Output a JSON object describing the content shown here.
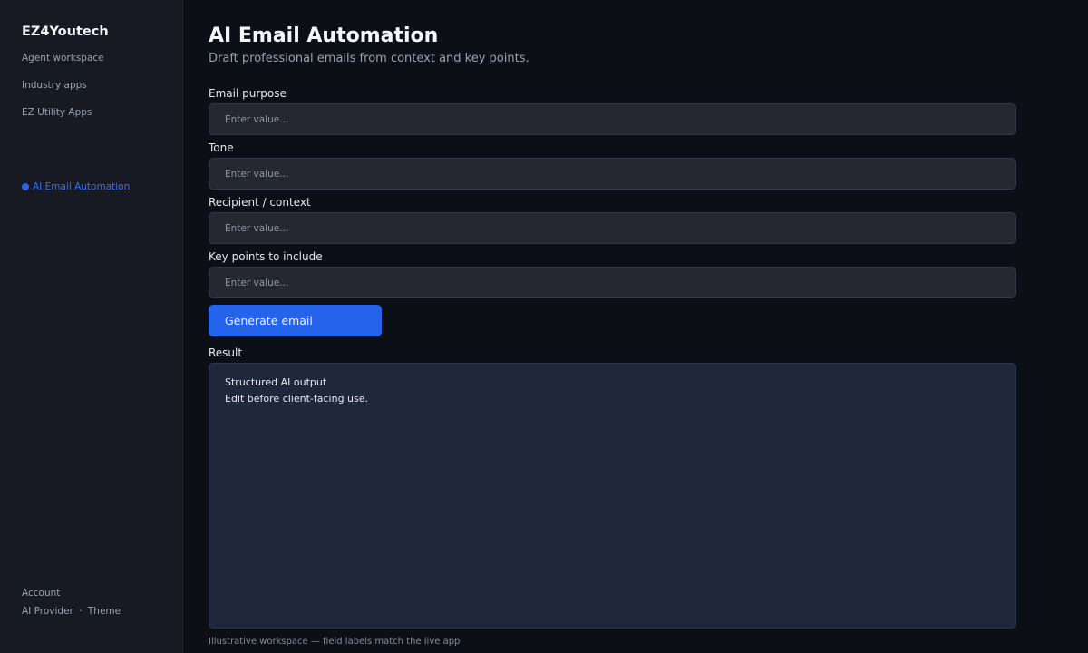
{
  "sidebar": {
    "brand": "EZ4Youtech",
    "nav": [
      {
        "label": "Agent workspace"
      },
      {
        "label": "Industry apps"
      },
      {
        "label": "EZ Utility Apps"
      }
    ],
    "active_item": {
      "label": "AI Email Automation"
    },
    "footer": {
      "account": "Account",
      "ai_provider": "AI Provider",
      "separator": "·",
      "theme": "Theme"
    }
  },
  "main": {
    "title": "AI Email Automation",
    "subtitle": "Draft professional emails from context and key points.",
    "fields": [
      {
        "label": "Email purpose",
        "placeholder": "Enter value...",
        "value": ""
      },
      {
        "label": "Tone",
        "placeholder": "Enter value...",
        "value": ""
      },
      {
        "label": "Recipient / context",
        "placeholder": "Enter value...",
        "value": ""
      },
      {
        "label": "Key points to include",
        "placeholder": "Enter value...",
        "value": ""
      }
    ],
    "generate_button": "Generate email",
    "result": {
      "label": "Result",
      "line1": "Structured AI output",
      "line2": "Edit before client-facing use."
    },
    "caption": "Illustrative workspace — field labels match the live app"
  },
  "colors": {
    "accent": "#2563eb",
    "active_nav": "#3b6ff0",
    "background": "#0d0f16",
    "sidebar_bg": "#171923",
    "result_bg": "#1e283a"
  }
}
